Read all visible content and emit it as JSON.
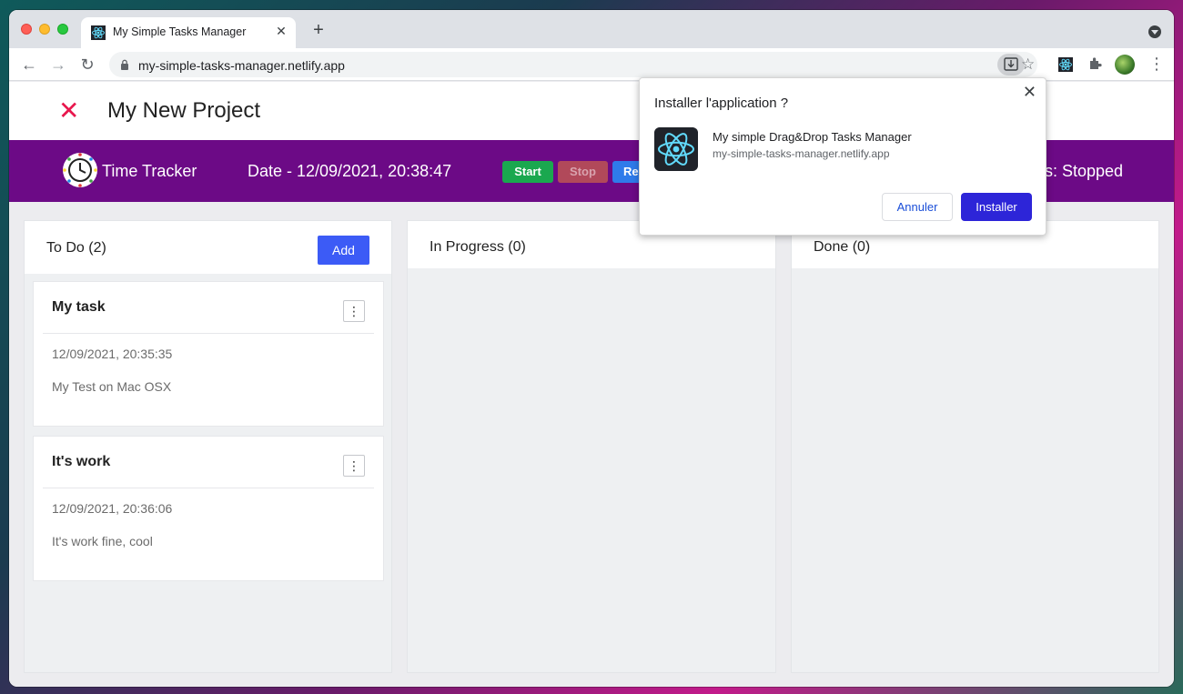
{
  "browser": {
    "tab_title": "My Simple Tasks Manager",
    "tab_close": "✕",
    "new_tab": "+",
    "url": "my-simple-tasks-manager.netlify.app"
  },
  "app": {
    "close_icon": "✕",
    "project_title": "My New Project"
  },
  "tracker": {
    "label": "Time Tracker",
    "date": "Date - 12/09/2021, 20:38:47",
    "start_label": "Start",
    "stop_label": "Stop",
    "reset_label": "Re",
    "status": "s: Stopped",
    "color": "#6c0a86"
  },
  "columns": [
    {
      "title": "To Do (2)",
      "add_label": "Add",
      "cards": [
        {
          "title": "My task",
          "menu": "⋮",
          "date": "12/09/2021, 20:35:35",
          "description": "My Test on Mac OSX"
        },
        {
          "title": "It's work",
          "menu": "⋮",
          "date": "12/09/2021, 20:36:06",
          "description": "It's work fine, cool"
        }
      ]
    },
    {
      "title": "In Progress (0)"
    },
    {
      "title": "Done (0)"
    }
  ],
  "install_dialog": {
    "title": "Installer l'application ?",
    "close": "✕",
    "app_name": "My simple Drag&Drop Tasks Manager",
    "app_url": "my-simple-tasks-manager.netlify.app",
    "cancel_label": "Annuler",
    "install_label": "Installer"
  },
  "colors": {
    "accent": "#3c5bf6",
    "install_button": "#2d25d8",
    "close_x": "#e8174d",
    "start": "#1aa84f",
    "stop": "#b1495a",
    "reset": "#2f7bea"
  }
}
